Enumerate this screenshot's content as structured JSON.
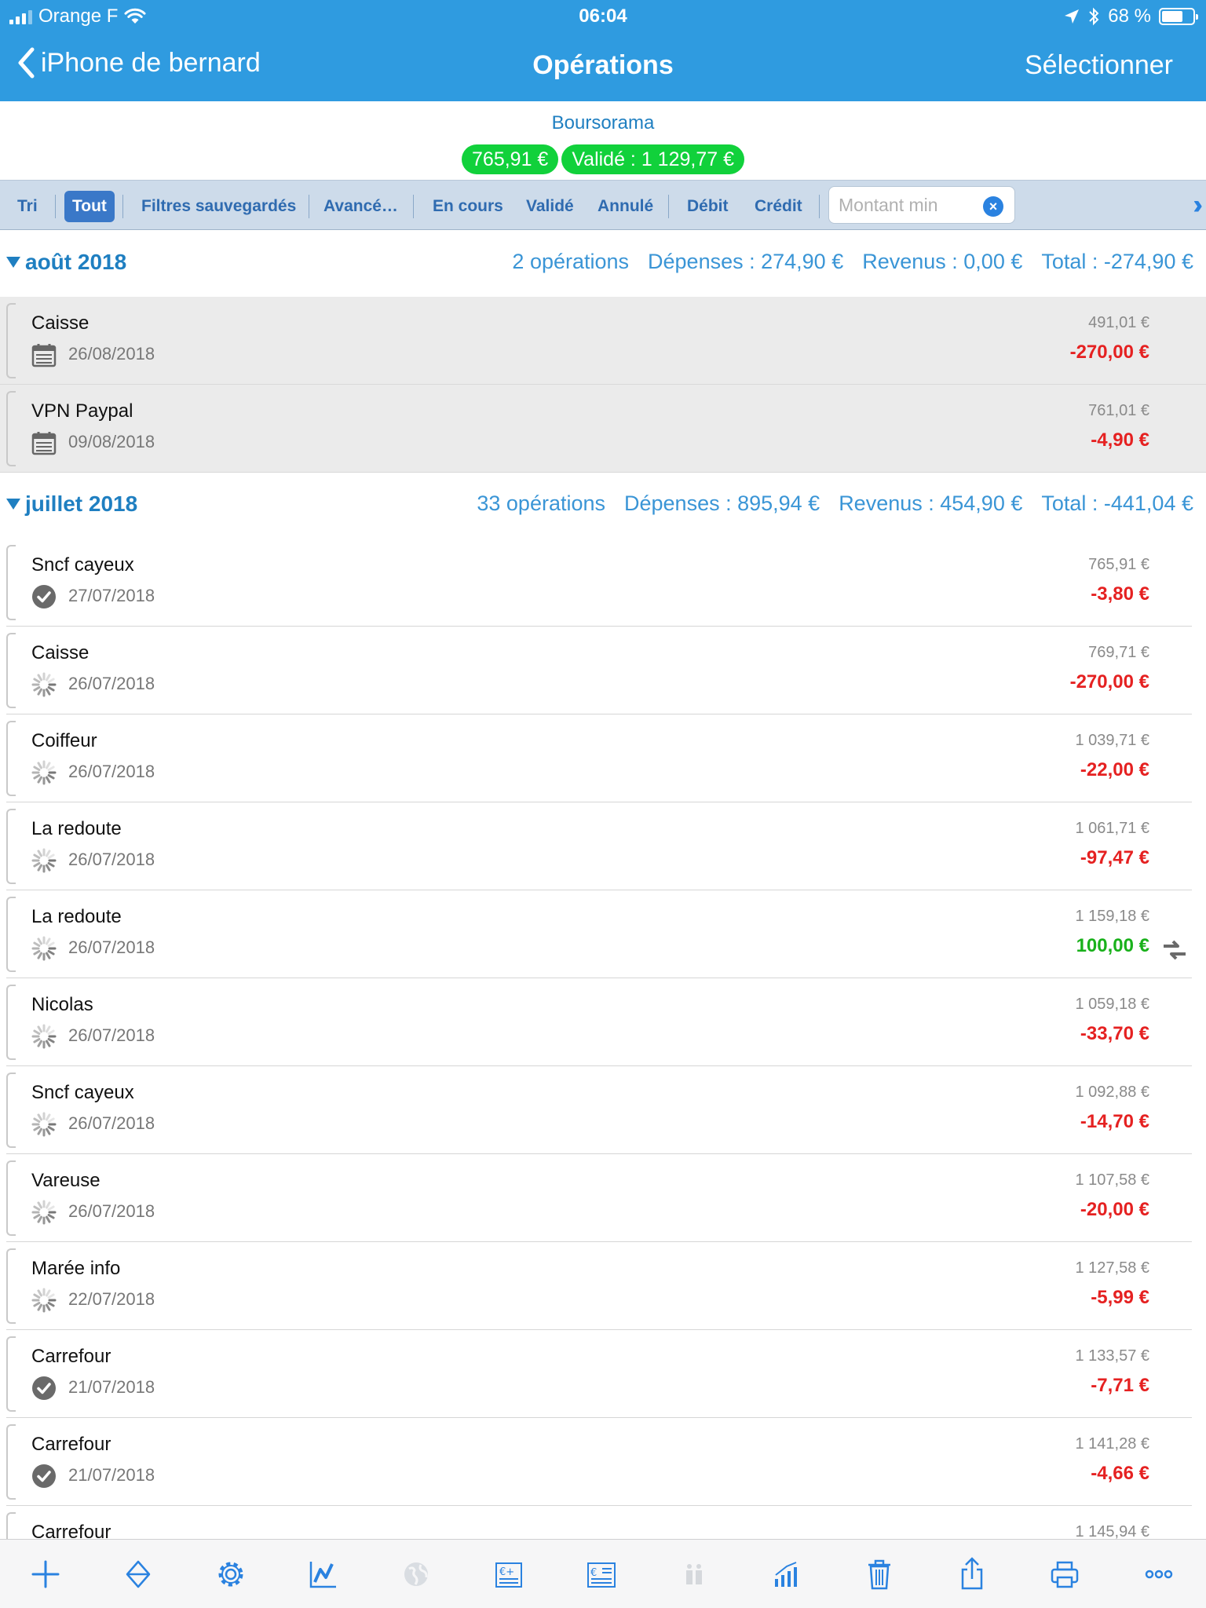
{
  "status": {
    "carrier": "Orange F",
    "time": "06:04",
    "battery": "68 %",
    "battery_level": 0.68
  },
  "nav": {
    "back_label": "iPhone de bernard",
    "title": "Opérations",
    "select_label": "Sélectionner"
  },
  "account": {
    "name": "Boursorama",
    "balance": "765,91 €",
    "validated": "Validé : 1 129,77 €"
  },
  "filters": {
    "sort": "Tri",
    "all": "Tout",
    "saved": "Filtres sauvegardés",
    "advanced": "Avancé…",
    "pending": "En cours",
    "validated": "Validé",
    "cancelled": "Annulé",
    "debit": "Débit",
    "credit": "Crédit",
    "amount_placeholder": "Montant min"
  },
  "months": [
    {
      "name": "août 2018",
      "count": "2 opérations",
      "expenses": "Dépenses : 274,90 €",
      "income": "Revenus : 0,00 €",
      "total": "Total : -274,90 €",
      "rows": [
        {
          "label": "Caisse",
          "date": "26/08/2018",
          "balance": "491,01 €",
          "amount": "-270,00 €",
          "status": "planned"
        },
        {
          "label": "VPN Paypal",
          "date": "09/08/2018",
          "balance": "761,01 €",
          "amount": "-4,90 €",
          "status": "planned"
        }
      ]
    },
    {
      "name": "juillet 2018",
      "count": "33 opérations",
      "expenses": "Dépenses : 895,94 €",
      "income": "Revenus : 454,90 €",
      "total": "Total : -441,04 €",
      "rows": [
        {
          "label": "Sncf cayeux",
          "date": "27/07/2018",
          "balance": "765,91 €",
          "amount": "-3,80 €",
          "status": "validated"
        },
        {
          "label": "Caisse",
          "date": "26/07/2018",
          "balance": "769,71 €",
          "amount": "-270,00 €",
          "status": "pending"
        },
        {
          "label": "Coiffeur",
          "date": "26/07/2018",
          "balance": "1 039,71 €",
          "amount": "-22,00 €",
          "status": "pending"
        },
        {
          "label": "La redoute",
          "date": "26/07/2018",
          "balance": "1 061,71 €",
          "amount": "-97,47 €",
          "status": "pending"
        },
        {
          "label": "La redoute",
          "date": "26/07/2018",
          "balance": "1 159,18 €",
          "amount": "100,00 €",
          "status": "pending",
          "transfer": true
        },
        {
          "label": "Nicolas",
          "date": "26/07/2018",
          "balance": "1 059,18 €",
          "amount": "-33,70 €",
          "status": "pending"
        },
        {
          "label": "Sncf cayeux",
          "date": "26/07/2018",
          "balance": "1 092,88 €",
          "amount": "-14,70 €",
          "status": "pending"
        },
        {
          "label": "Vareuse",
          "date": "26/07/2018",
          "balance": "1 107,58 €",
          "amount": "-20,00 €",
          "status": "pending"
        },
        {
          "label": "Marée info",
          "date": "22/07/2018",
          "balance": "1 127,58 €",
          "amount": "-5,99 €",
          "status": "pending"
        },
        {
          "label": "Carrefour",
          "date": "21/07/2018",
          "balance": "1 133,57 €",
          "amount": "-7,71 €",
          "status": "validated"
        },
        {
          "label": "Carrefour",
          "date": "21/07/2018",
          "balance": "1 141,28 €",
          "amount": "-4,66 €",
          "status": "validated"
        },
        {
          "label": "Carrefour",
          "date": "",
          "balance": "1 145,94 €",
          "amount": "",
          "status": "validated"
        }
      ]
    }
  ],
  "colors": {
    "accent": "#2f9be0",
    "pill_green": "#11d13b",
    "negative": "#e52121",
    "positive": "#19b11b"
  },
  "toolbar": [
    "add-icon",
    "sort-icon",
    "settings-icon",
    "chart-icon",
    "globe-icon",
    "add-currency-icon",
    "currency-list-icon",
    "people-icon",
    "bar-chart-icon",
    "trash-icon",
    "share-icon",
    "print-icon",
    "more-icon"
  ]
}
